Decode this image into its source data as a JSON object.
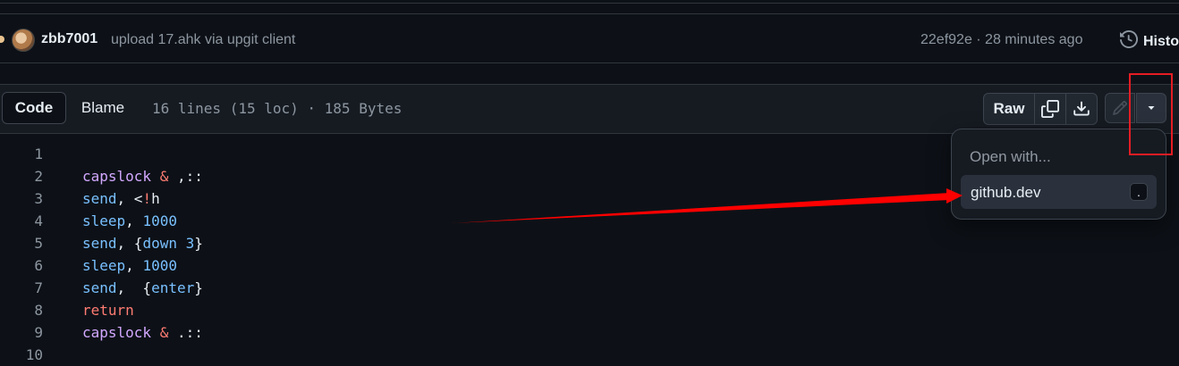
{
  "commit": {
    "author": "zbb7001",
    "message": "upload 17.ahk via upgit client",
    "meta": "22ef92e · 28 minutes ago",
    "history_label": "History"
  },
  "file_header": {
    "code_tab": "Code",
    "blame_tab": "Blame",
    "info": "16 lines (15 loc) · 185 Bytes",
    "raw_label": "Raw"
  },
  "dropdown": {
    "title": "Open with...",
    "item_label": "github.dev",
    "shortcut": "."
  },
  "code_lines": [
    {
      "n": "1",
      "segments": []
    },
    {
      "n": "2",
      "segments": [
        [
          "kw",
          "capslock"
        ],
        [
          "pl",
          " "
        ],
        [
          "op",
          "&"
        ],
        [
          "pl",
          " ,::"
        ]
      ]
    },
    {
      "n": "3",
      "segments": [
        [
          "fn",
          "send"
        ],
        [
          "pl",
          ", <"
        ],
        [
          "op",
          "!"
        ],
        [
          "pl",
          "h"
        ]
      ]
    },
    {
      "n": "4",
      "segments": [
        [
          "fn",
          "sleep"
        ],
        [
          "pl",
          ", "
        ],
        [
          "fn",
          "1000"
        ]
      ]
    },
    {
      "n": "5",
      "segments": [
        [
          "fn",
          "send"
        ],
        [
          "pl",
          ", {"
        ],
        [
          "fn",
          "down"
        ],
        [
          "pl",
          " "
        ],
        [
          "fn",
          "3"
        ],
        [
          "pl",
          "}"
        ]
      ]
    },
    {
      "n": "6",
      "segments": [
        [
          "fn",
          "sleep"
        ],
        [
          "pl",
          ", "
        ],
        [
          "fn",
          "1000"
        ]
      ]
    },
    {
      "n": "7",
      "segments": [
        [
          "fn",
          "send"
        ],
        [
          "pl",
          ",  {"
        ],
        [
          "fn",
          "enter"
        ],
        [
          "pl",
          "}"
        ]
      ]
    },
    {
      "n": "8",
      "segments": [
        [
          "op",
          "return"
        ]
      ]
    },
    {
      "n": "9",
      "segments": [
        [
          "kw",
          "capslock"
        ],
        [
          "pl",
          " "
        ],
        [
          "op",
          "&"
        ],
        [
          "pl",
          " .::"
        ]
      ]
    },
    {
      "n": "10",
      "segments": []
    }
  ],
  "colors": {
    "background": "#0d1117",
    "annotation_red": "#e51c23",
    "keyword": "#d2a8ff",
    "function": "#79c0ff",
    "operator": "#ff7b72"
  }
}
